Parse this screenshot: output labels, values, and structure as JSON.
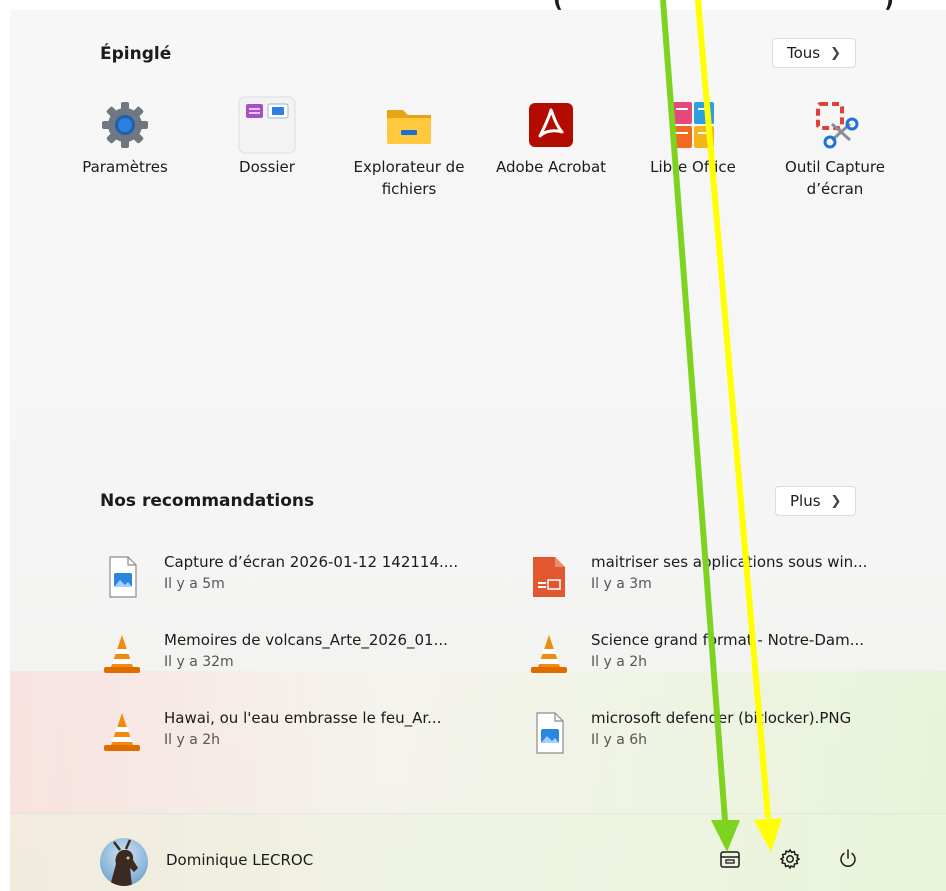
{
  "pinned": {
    "title": "Épinglé",
    "all_button": "Tous",
    "apps": [
      {
        "label": "Paramètres",
        "icon": "gear-icon"
      },
      {
        "label": "Dossier",
        "icon": "folder-group-icon"
      },
      {
        "label": "Explorateur de fichiers",
        "icon": "file-explorer-icon"
      },
      {
        "label": "Adobe Acrobat",
        "icon": "acrobat-icon"
      },
      {
        "label": "Libre Office",
        "icon": "libreoffice-icon"
      },
      {
        "label": "Outil Capture d’écran",
        "icon": "snipping-tool-icon"
      }
    ]
  },
  "recommendations": {
    "title": "Nos recommandations",
    "more_button": "Plus",
    "items": [
      {
        "name": "Capture d’écran 2026-01-12 142114....",
        "time": "Il y a 5m",
        "icon": "image-file-icon"
      },
      {
        "name": "maitriser ses applications sous win...",
        "time": "Il y a 3m",
        "icon": "powerpoint-file-icon"
      },
      {
        "name": "Memoires de volcans_Arte_2026_01...",
        "time": "Il y a 32m",
        "icon": "vlc-icon"
      },
      {
        "name": "Science grand format - Notre-Dam...",
        "time": "Il y a 2h",
        "icon": "vlc-icon"
      },
      {
        "name": "Hawai, ou l'eau embrasse le feu_Ar...",
        "time": "Il y a 2h",
        "icon": "vlc-icon"
      },
      {
        "name": "microsoft defender (bitlocker).PNG",
        "time": "Il y a 6h",
        "icon": "image-file-icon"
      }
    ]
  },
  "footer": {
    "user_name": "Dominique LECROC",
    "buttons": [
      "file-explorer-icon",
      "gear-icon",
      "power-icon"
    ]
  },
  "colors": {
    "arrow_green": "#7ed321",
    "arrow_yellow": "#ffff00",
    "accent_blue": "#0067c0"
  }
}
